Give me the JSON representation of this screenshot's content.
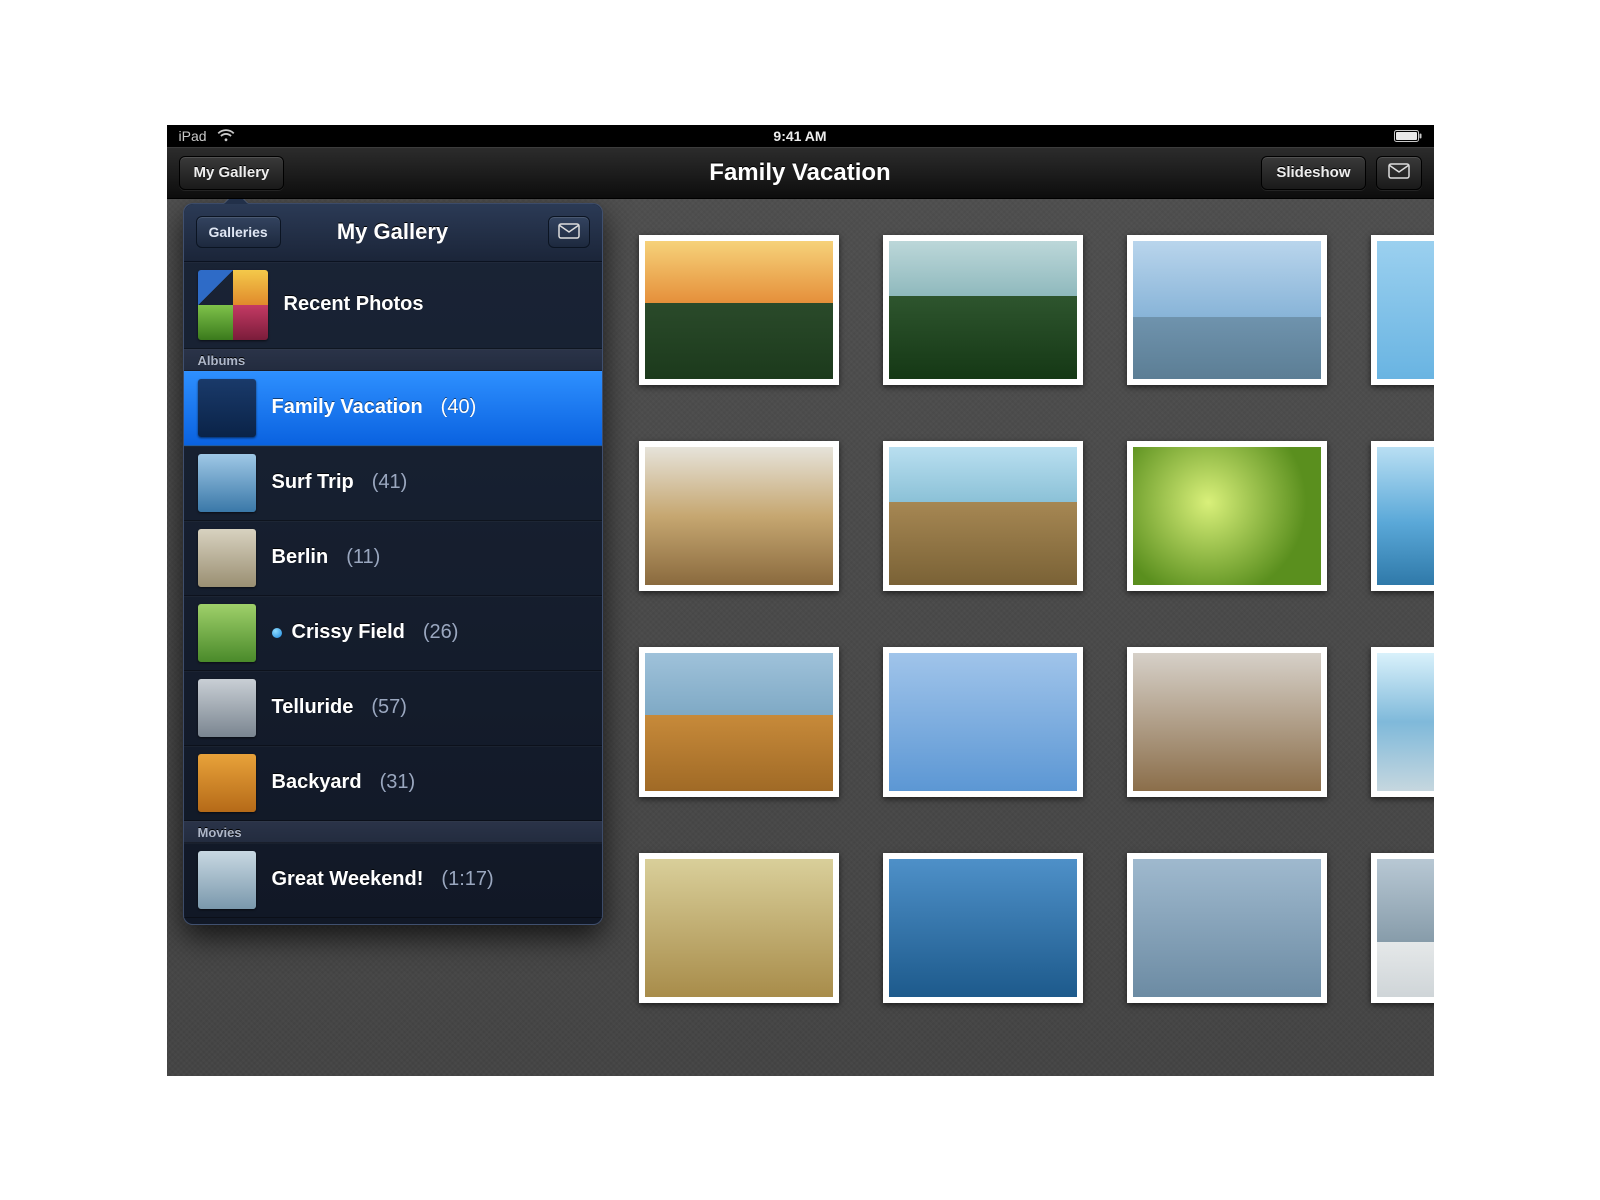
{
  "statusbar": {
    "device": "iPad",
    "time": "9:41 AM"
  },
  "navbar": {
    "back_label": "My Gallery",
    "title": "Family Vacation",
    "slideshow_label": "Slideshow"
  },
  "popover": {
    "back_label": "Galleries",
    "title": "My Gallery",
    "recent_label": "Recent Photos",
    "sections": {
      "albums": "Albums",
      "movies": "Movies"
    },
    "albums": [
      {
        "name": "Family Vacation",
        "count": "(40)",
        "selected": true,
        "dot": false
      },
      {
        "name": "Surf Trip",
        "count": "(41)",
        "selected": false,
        "dot": false
      },
      {
        "name": "Berlin",
        "count": "(11)",
        "selected": false,
        "dot": false
      },
      {
        "name": "Crissy Field",
        "count": "(26)",
        "selected": false,
        "dot": true
      },
      {
        "name": "Telluride",
        "count": "(57)",
        "selected": false,
        "dot": false
      },
      {
        "name": "Backyard",
        "count": "(31)",
        "selected": false,
        "dot": false
      }
    ],
    "movies": [
      {
        "name": "Great Weekend!",
        "meta": "(1:17)"
      }
    ]
  }
}
